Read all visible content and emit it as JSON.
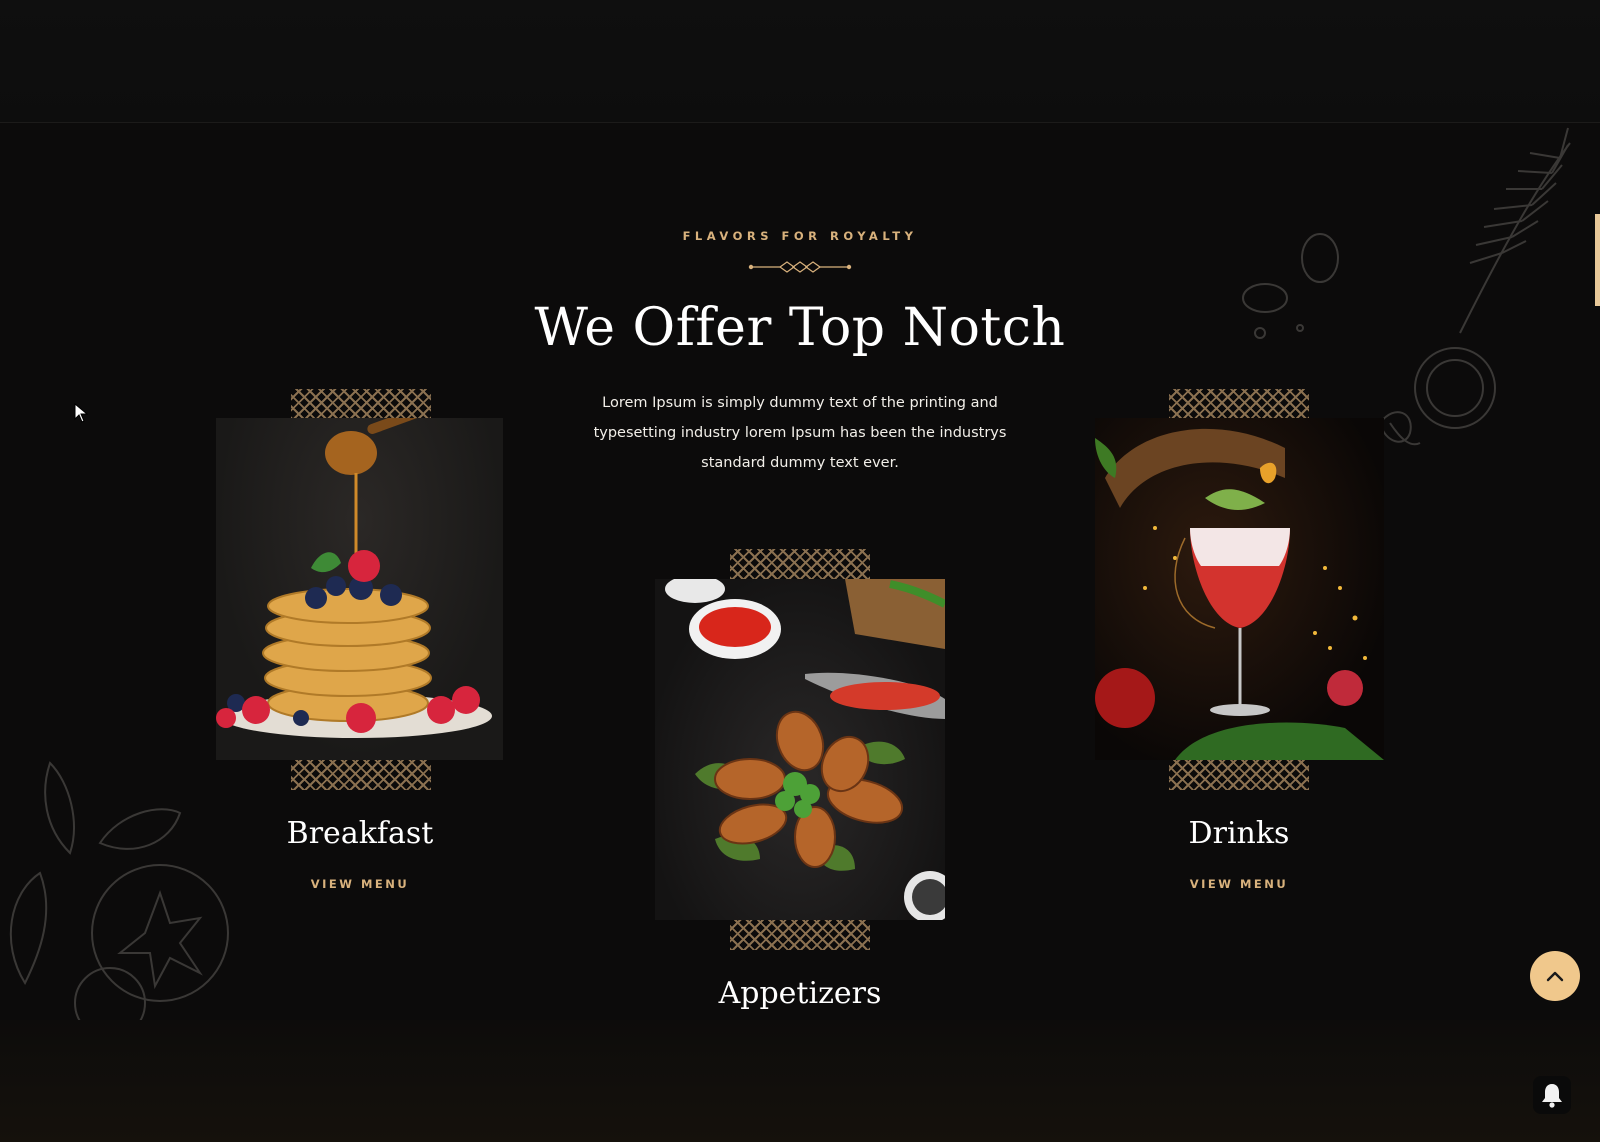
{
  "section": {
    "eyebrow": "FLAVORS FOR ROYALTY",
    "title": "We Offer Top Notch",
    "description": "Lorem Ipsum is simply dummy text of the printing and typesetting industry lorem Ipsum has been the industrys standard dummy text ever."
  },
  "categories": [
    {
      "name": "Breakfast",
      "link": "VIEW MENU"
    },
    {
      "name": "Appetizers",
      "link": ""
    },
    {
      "name": "Drinks",
      "link": "VIEW MENU"
    }
  ],
  "colors": {
    "background": "#0c0b0b",
    "accent_gold": "#d9b27d",
    "scroll_button": "#f0c88c"
  },
  "icons": {
    "scroll_top": "chevron-up-icon",
    "notifications": "bell-icon",
    "cursor": "mouse-pointer-icon"
  }
}
